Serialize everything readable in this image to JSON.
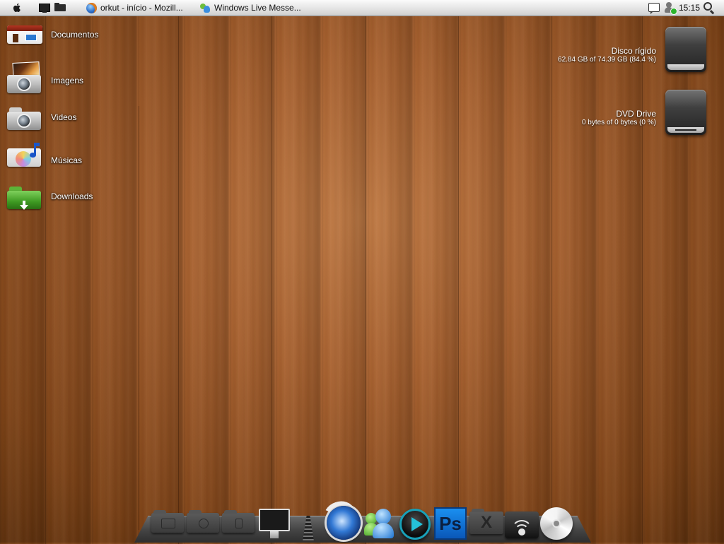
{
  "topbar": {
    "tasks": [
      {
        "label": "orkut - início - Mozill...",
        "icon": "firefox-icon"
      },
      {
        "label": "Windows Live Messe...",
        "icon": "messenger-icon"
      }
    ],
    "clock": "15:15"
  },
  "desktop": {
    "items": [
      {
        "label": "Documentos",
        "icon": "home-folder-icon"
      },
      {
        "label": "Imagens",
        "icon": "pictures-folder-icon"
      },
      {
        "label": "Videos",
        "icon": "camera-folder-icon"
      },
      {
        "label": "Músicas",
        "icon": "music-folder-icon"
      },
      {
        "label": "Downloads",
        "icon": "downloads-folder-icon"
      }
    ],
    "drives": [
      {
        "name": "Disco rígido",
        "usage": "62.84 GB of 74.39 GB (84.4 %)",
        "icon": "hard-disk-icon"
      },
      {
        "name": "DVD Drive",
        "usage": "0 bytes of 0 bytes (0 %)",
        "icon": "dvd-drive-icon"
      }
    ]
  },
  "dock": {
    "items": [
      "photos-folder-icon",
      "camera-folder-icon",
      "music-folder-icon",
      "imac-icon",
      "trash-icon",
      "firefox-icon",
      "messenger-icon",
      "media-player-icon",
      "photoshop-icon",
      "applications-folder-icon",
      "wifi-icon",
      "dvd-icon"
    ],
    "photoshop_label": "Ps",
    "x_label": "X"
  },
  "colors": {
    "wood": "#a8612f",
    "topbar": "#e2e2e2",
    "dock_shelf": "#464646"
  }
}
